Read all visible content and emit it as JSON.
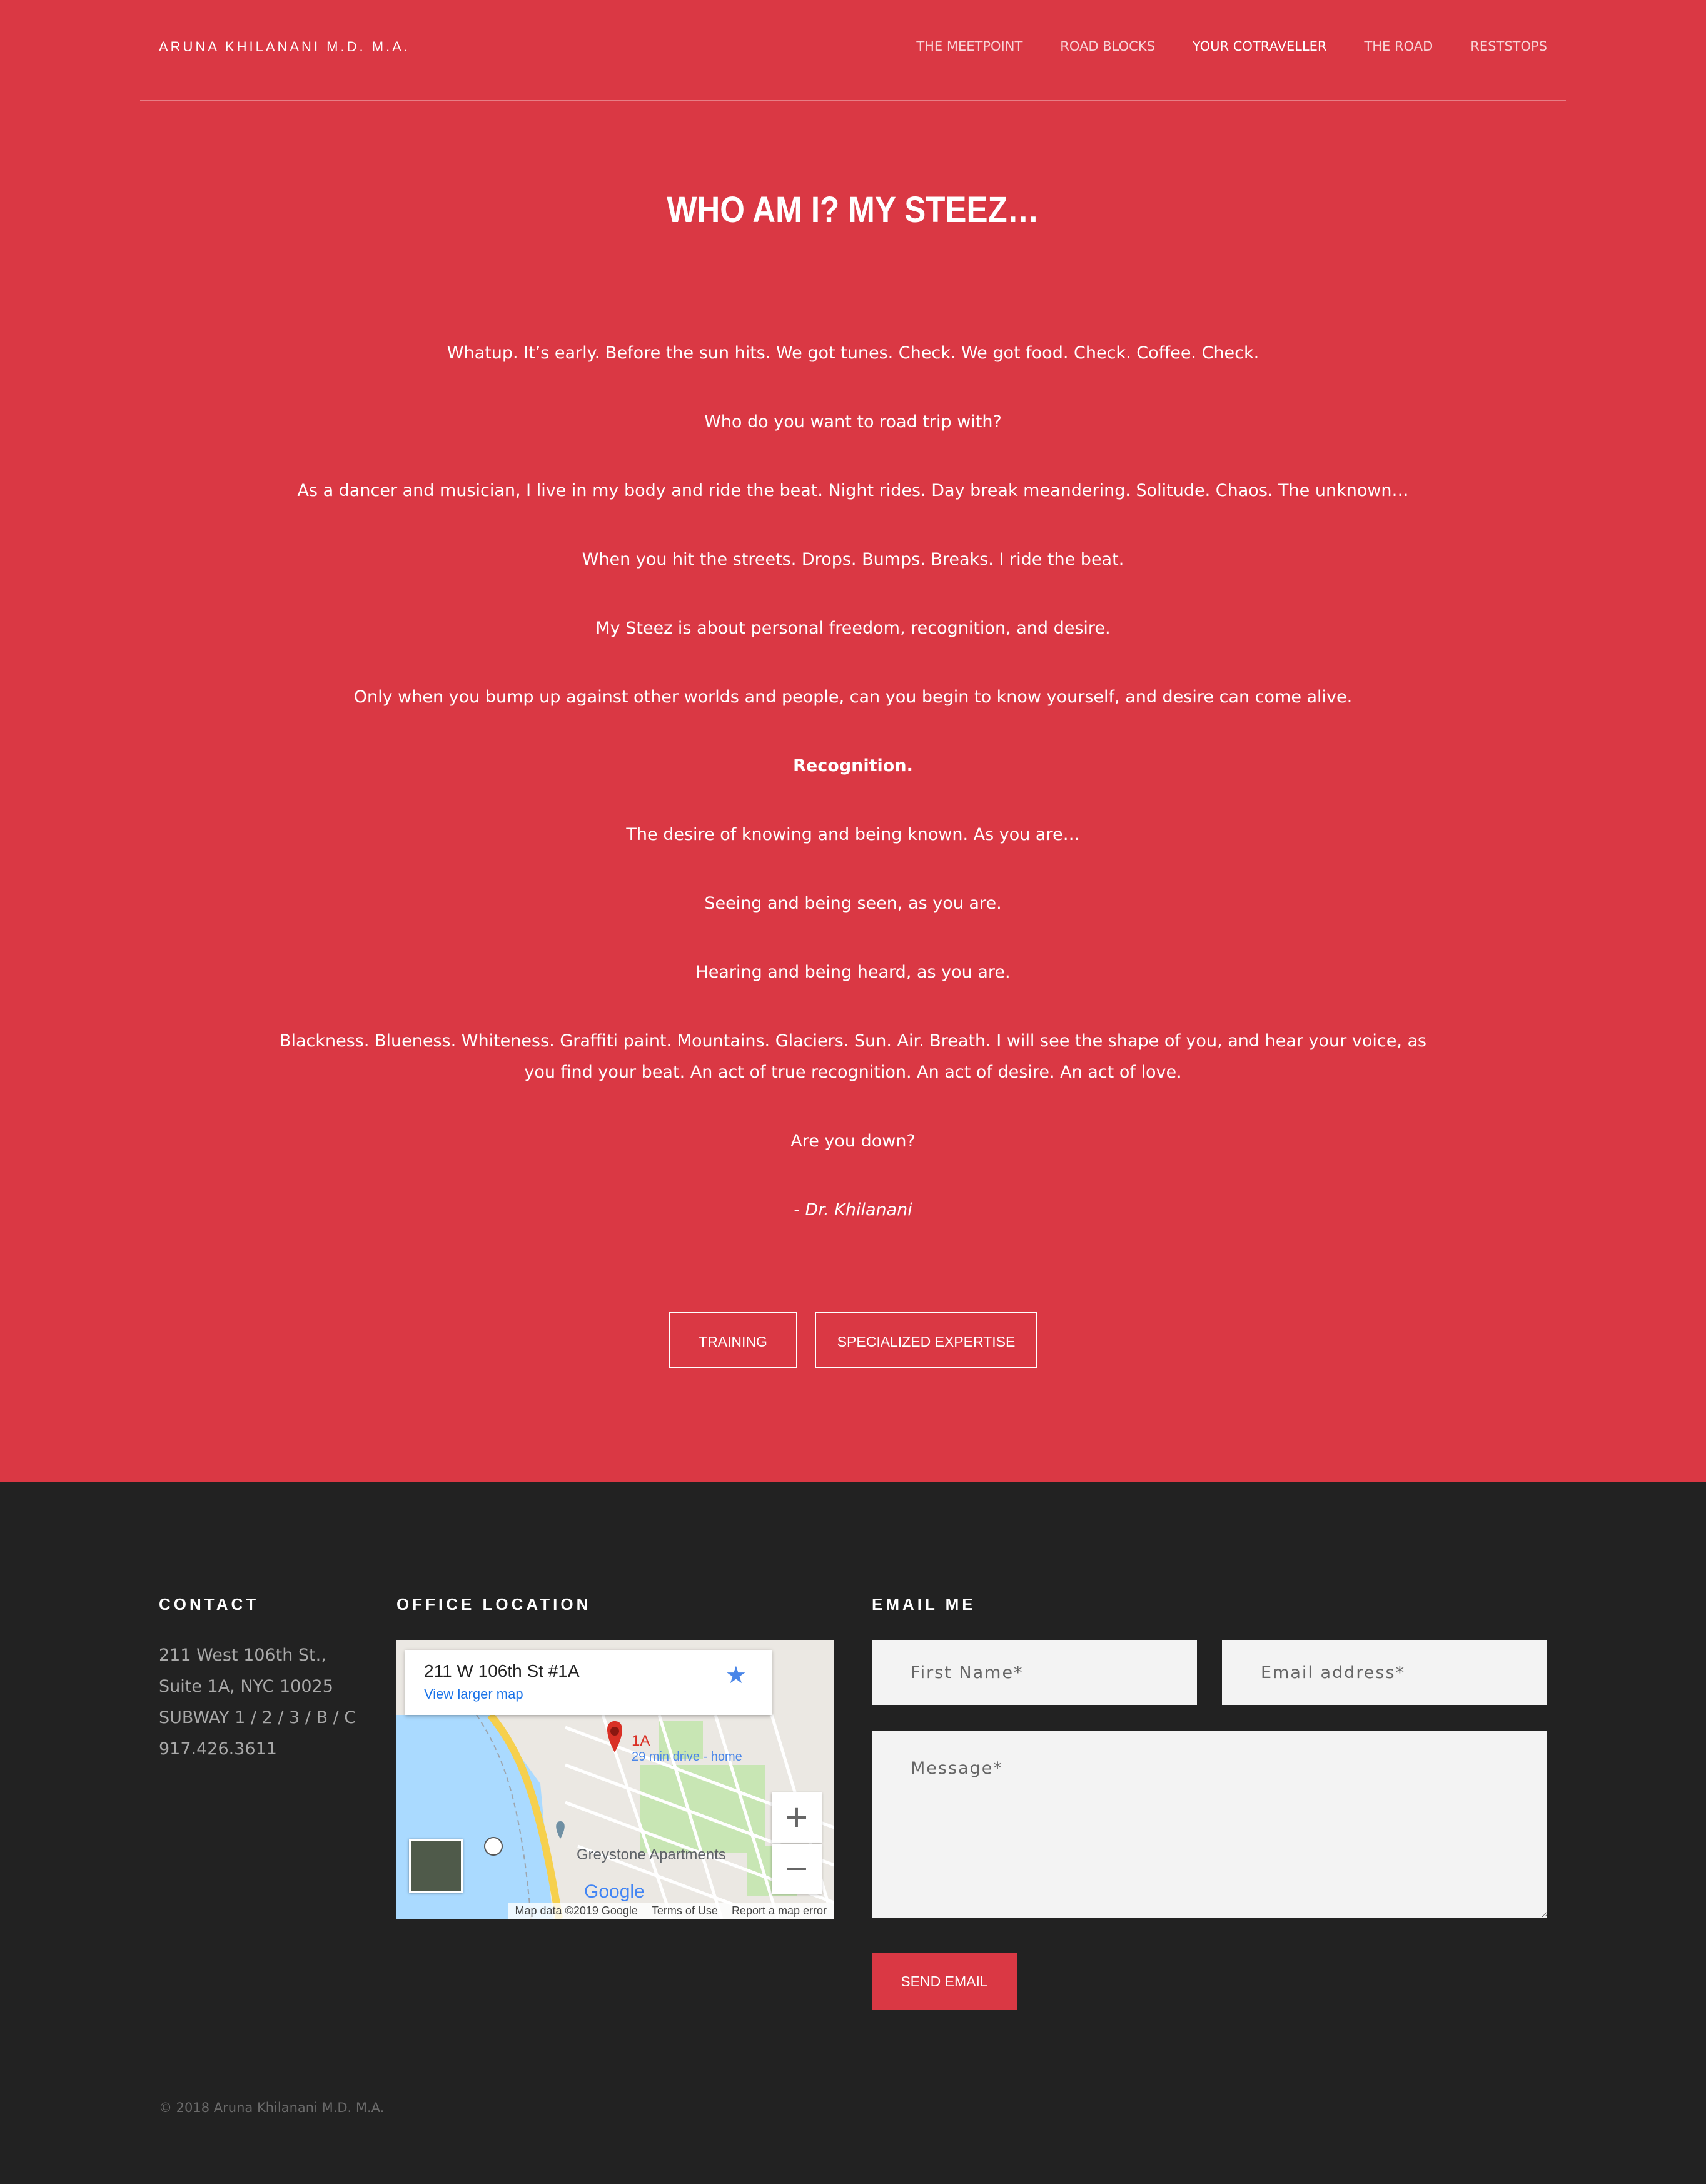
{
  "header": {
    "brand": "ARUNA KHILANANI M.D. M.A.",
    "nav": [
      {
        "label": "THE MEETPOINT"
      },
      {
        "label": "ROAD BLOCKS"
      },
      {
        "label": "YOUR COTRAVELLER",
        "active": true
      },
      {
        "label": "THE ROAD"
      },
      {
        "label": "RESTSTOPS"
      }
    ]
  },
  "main": {
    "title": "WHO AM I? MY STEEZ…",
    "paragraphs": [
      "Whatup. It’s early. Before the sun hits. We got tunes. Check. We got food. Check. Coffee. Check.",
      "Who do you want to road trip with?",
      "As a dancer and musician, I live in my body and ride the beat. Night rides. Day break meandering. Solitude. Chaos. The unknown…",
      "When you hit the streets. Drops. Bumps. Breaks. I ride the beat.",
      "My Steez is about personal freedom, recognition, and desire.",
      "Only when you bump up against other worlds and people, can you begin to know yourself, and desire can come alive.",
      "Recognition.",
      "The desire of knowing and being known. As you are…",
      "Seeing and being seen, as you are.",
      "Hearing and being heard, as you are.",
      "Blackness. Blueness. Whiteness. Graffiti paint. Mountains. Glaciers. Sun. Air. Breath. I will see the shape of you, and hear your voice, as you find your beat. An act of true recognition. An act of desire. An act of love.",
      "Are you down?",
      "- Dr. Khilanani"
    ],
    "buttons": {
      "training": "TRAINING",
      "expertise": "SPECIALIZED EXPERTISE"
    }
  },
  "footer": {
    "contact": {
      "heading": "CONTACT",
      "lines": [
        "211 West 106th St.,",
        "Suite 1A, NYC 10025",
        "SUBWAY 1 / 2 / 3 / B / C",
        "917.426.3611"
      ]
    },
    "office": {
      "heading": "OFFICE LOCATION",
      "map": {
        "address": "211 W 106th St #1A",
        "link": "View larger map",
        "pin_label": "1A",
        "drive": "29 min drive - home",
        "place": "Greystone Apartments",
        "logo": "Google",
        "attribution": [
          "Map data ©2019 Google",
          "Terms of Use",
          "Report a map error"
        ]
      }
    },
    "email": {
      "heading": "EMAIL ME",
      "first_name_placeholder": "First Name*",
      "email_placeholder": "Email address*",
      "message_placeholder": "Message*",
      "send_label": "SEND EMAIL"
    },
    "copyright": "© 2018 Aruna Khilanani M.D. M.A."
  },
  "colors": {
    "accent": "#da3844",
    "footer_bg": "#222222"
  }
}
